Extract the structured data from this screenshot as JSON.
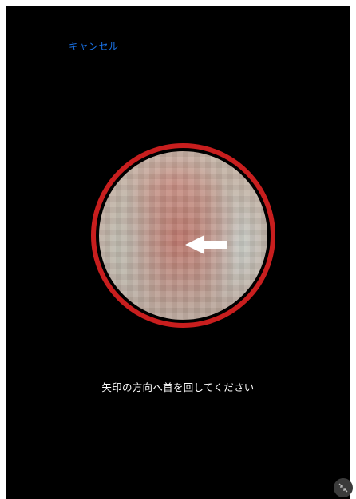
{
  "header": {
    "cancel_label": "キャンセル"
  },
  "camera": {
    "direction_arrow": "left-arrow-icon"
  },
  "instruction": {
    "text": "矢印の方向へ首を回してください"
  },
  "controls": {
    "minimize_icon": "minimize-icon"
  },
  "colors": {
    "background": "#000000",
    "cancel_link": "#1a73e8",
    "ring": "#c81e1e",
    "text": "#ffffff"
  }
}
